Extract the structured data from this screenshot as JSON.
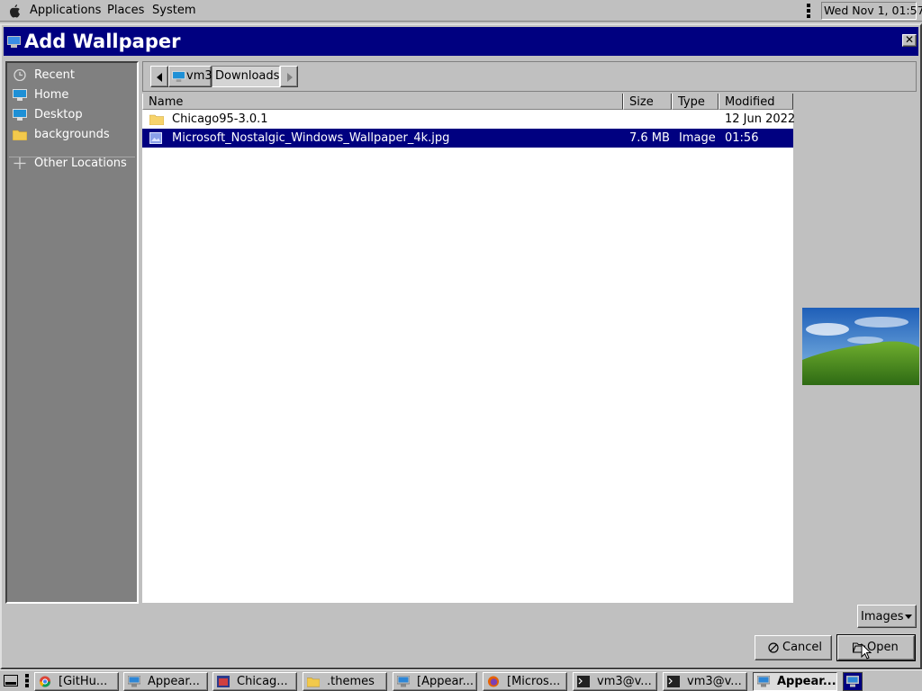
{
  "top_panel": {
    "menus": [
      "Applications",
      "Places",
      "System"
    ],
    "clock": "Wed Nov 1, 01:57",
    "icons": [
      "apple-logo-icon",
      "kebab-menu-icon"
    ]
  },
  "dialog": {
    "title": "Add Wallpaper",
    "close_glyph": "✕"
  },
  "sidebar": {
    "items": [
      {
        "label": "Recent",
        "icon": "clock-icon"
      },
      {
        "label": "Home",
        "icon": "monitor-icon"
      },
      {
        "label": "Desktop",
        "icon": "monitor-icon"
      },
      {
        "label": "backgrounds",
        "icon": "folder-icon"
      },
      {
        "label": "Other Locations",
        "icon": "plus-icon"
      }
    ]
  },
  "pathbar": {
    "crumbs": [
      "vm3",
      "Downloads"
    ]
  },
  "filelist": {
    "columns": [
      "Name",
      "Size",
      "Type",
      "Modified"
    ],
    "rows": [
      {
        "name": "Chicago95-3.0.1",
        "size": "",
        "type": "",
        "modified": "12 Jun 2022",
        "icon": "folder-icon"
      },
      {
        "name": "Microsoft_Nostalgic_Windows_Wallpaper_4k.jpg",
        "size": "7.6 MB",
        "type": "Image",
        "modified": "01:56",
        "icon": "image-file-icon",
        "selected": true
      }
    ]
  },
  "controls": {
    "filter": "Images",
    "cancel": "Cancel",
    "open": "Open"
  },
  "taskbar": {
    "tasks": [
      "[GitHu...",
      "Appear...",
      "Chicag...",
      ".themes",
      "[Appear...",
      "[Micros...",
      "vm3@v...",
      "vm3@v...",
      "Appear..."
    ]
  },
  "colors": {
    "titlebar": "#000080",
    "selection": "#000080",
    "surface": "#c0c0c0",
    "sidebar": "#808080"
  }
}
